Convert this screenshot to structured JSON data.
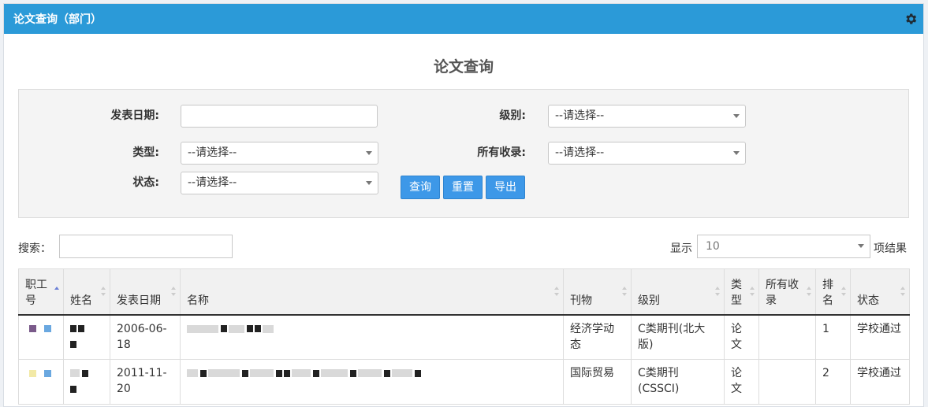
{
  "header": {
    "title": "论文查询（部门）",
    "settings_icon": "gear-icon"
  },
  "page": {
    "title": "论文查询"
  },
  "filters": {
    "publish_date": {
      "label": "发表日期:",
      "value": ""
    },
    "level": {
      "label": "级别:",
      "value": "--请选择--"
    },
    "type": {
      "label": "类型:",
      "value": "--请选择--"
    },
    "included_in": {
      "label": "所有收录:",
      "value": "--请选择--"
    },
    "status": {
      "label": "状态:",
      "value": "--请选择--"
    },
    "buttons": {
      "query": "查询",
      "reset": "重置",
      "export": "导出"
    }
  },
  "search": {
    "label": "搜索：",
    "value": ""
  },
  "page_size": {
    "show_label": "显示",
    "value": "10",
    "results_label": "项结果"
  },
  "table": {
    "columns": [
      "职工号",
      "姓名",
      "发表日期",
      "名称",
      "刊物",
      "级别",
      "类型",
      "所有收录",
      "排名",
      "状态"
    ],
    "rows": [
      {
        "date": "2006-06-18",
        "journal": "经济学动态",
        "level": "C类期刊(北大版)",
        "type": "论文",
        "included": "",
        "rank": "1",
        "status": "学校通过"
      },
      {
        "date": "2011-11-20",
        "journal": "国际贸易",
        "level": "C类期刊(CSSCI)",
        "type": "论文",
        "included": "",
        "rank": "2",
        "status": "学校通过"
      }
    ]
  },
  "colors": {
    "header_bg": "#2b9ad8",
    "button_bg": "#3d98e8"
  }
}
